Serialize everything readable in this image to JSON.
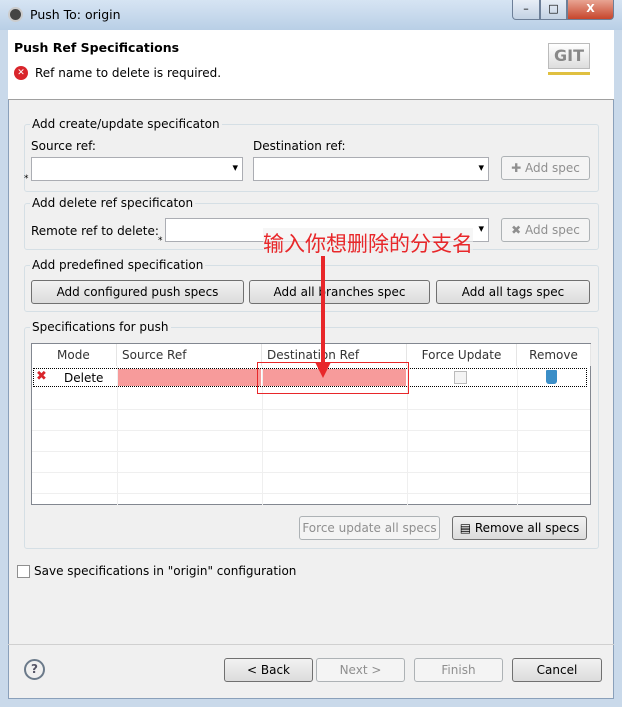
{
  "window": {
    "title": "Push To: origin",
    "minimize": "–",
    "maximize": "□",
    "close": "X"
  },
  "header": {
    "title": "Push Ref Specifications",
    "error": "Ref name to delete is required.",
    "logo": "GIT"
  },
  "create_group": {
    "label": "Add create/update specificaton",
    "source_label": "Source ref:",
    "dest_label": "Destination ref:",
    "source_value": "",
    "dest_value": "",
    "add_button": "Add spec"
  },
  "delete_group": {
    "label": "Add delete ref specificaton",
    "remote_label": "Remote ref to delete:",
    "remote_value": "",
    "add_button": "Add spec"
  },
  "predefined_group": {
    "label": "Add predefined specification",
    "buttons": [
      "Add configured push specs",
      "Add all branches spec",
      "Add all tags spec"
    ]
  },
  "specs_group": {
    "label": "Specifications for push",
    "columns": [
      "Mode",
      "Source Ref",
      "Destination Ref",
      "Force Update",
      "Remove"
    ],
    "rows": [
      {
        "mode": "Delete",
        "source": "",
        "destination": "",
        "force_update": false
      }
    ],
    "force_update_all": "Force update all specs",
    "remove_all": "Remove all specs"
  },
  "save_checkbox": {
    "label": "Save specifications in \"origin\" configuration",
    "checked": false
  },
  "footer": {
    "back": "< Back",
    "next": "Next >",
    "finish": "Finish",
    "cancel": "Cancel"
  },
  "annotation": {
    "text": "输入你想删除的分支名",
    "color": "#e8272a"
  },
  "colors": {
    "invalid_cell": "#f79b9b",
    "error": "#d9252b"
  }
}
